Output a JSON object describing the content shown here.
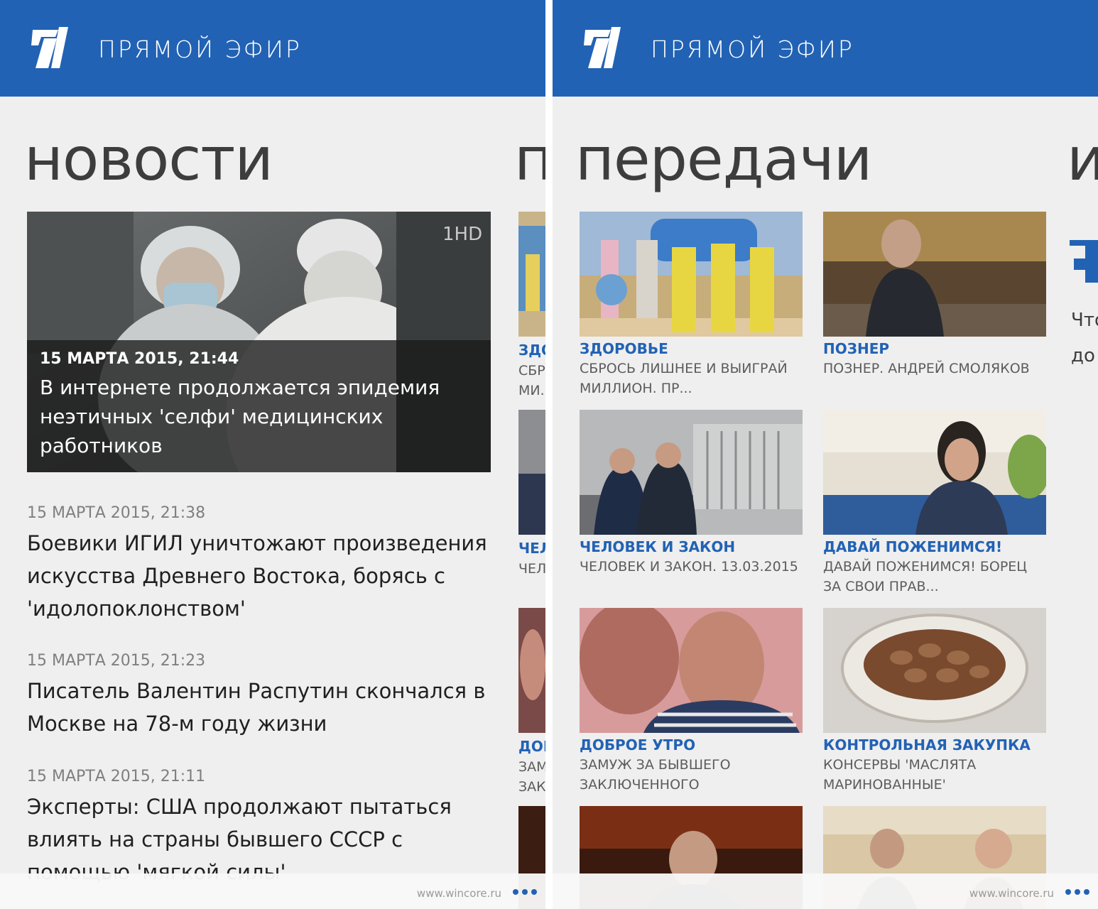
{
  "header": {
    "title": "ПРЯМОЙ ЭФИР",
    "logo_icon": "channel-one-logo",
    "bg_color": "#2262b4"
  },
  "left": {
    "pivot": "новости",
    "pivot_peek": "п",
    "featured": {
      "date": "15 МАРТА 2015, 21:44",
      "text": "В интернете продолжается эпидемия неэтичных 'селфи' медицинских работников"
    },
    "news": [
      {
        "date": "15 МАРТА 2015, 21:38",
        "text": "Боевики ИГИЛ уничтожают произведения искусства Древнего Востока, борясь с 'идолопоклонством'"
      },
      {
        "date": "15 МАРТА 2015, 21:23",
        "text": "Писатель Валентин Распутин скончался в Москве на 78-м году жизни"
      },
      {
        "date": "15 МАРТА 2015, 21:11",
        "text": "Эксперты: США продолжают пытаться влиять на страны бывшего СССР с помощью 'мягкой силы'"
      }
    ],
    "peek_items": [
      {
        "title": "ЗДО",
        "sub1": "СБР",
        "sub2": "МИ.."
      },
      {
        "title": "ЧЕЛ",
        "sub1": "ЧЕЛ",
        "sub2": ""
      },
      {
        "title": "ДОІ",
        "sub1": "ЗАМ",
        "sub2": "ЗАК"
      }
    ]
  },
  "right": {
    "pivot": "передачи",
    "pivot_peek": "и",
    "peek_text": [
      "Что",
      "до"
    ],
    "programs": [
      {
        "title": "ЗДОРОВЬЕ",
        "sub": "СБРОСЬ ЛИШНЕЕ И ВЫИГРАЙ МИЛЛИОН. ПР..."
      },
      {
        "title": "ПОЗНЕР",
        "sub": "ПОЗНЕР. АНДРЕЙ СМОЛЯКОВ"
      },
      {
        "title": "ЧЕЛОВЕК И ЗАКОН",
        "sub": "ЧЕЛОВЕК И ЗАКОН. 13.03.2015"
      },
      {
        "title": "ДАВАЙ ПОЖЕНИМСЯ!",
        "sub": "ДАВАЙ ПОЖЕНИМСЯ! БОРЕЦ ЗА СВОИ ПРАВ..."
      },
      {
        "title": "ДОБРОЕ УТРО",
        "sub": "ЗАМУЖ ЗА БЫВШЕГО ЗАКЛЮЧЕННОГО"
      },
      {
        "title": "КОНТРОЛЬНАЯ ЗАКУПКА",
        "sub": "КОНСЕРВЫ 'МАСЛЯТА МАРИНОВАННЫЕ'"
      }
    ]
  },
  "footer": {
    "watermark": "www.wincore.ru",
    "more_icon": "ellipsis-icon"
  }
}
